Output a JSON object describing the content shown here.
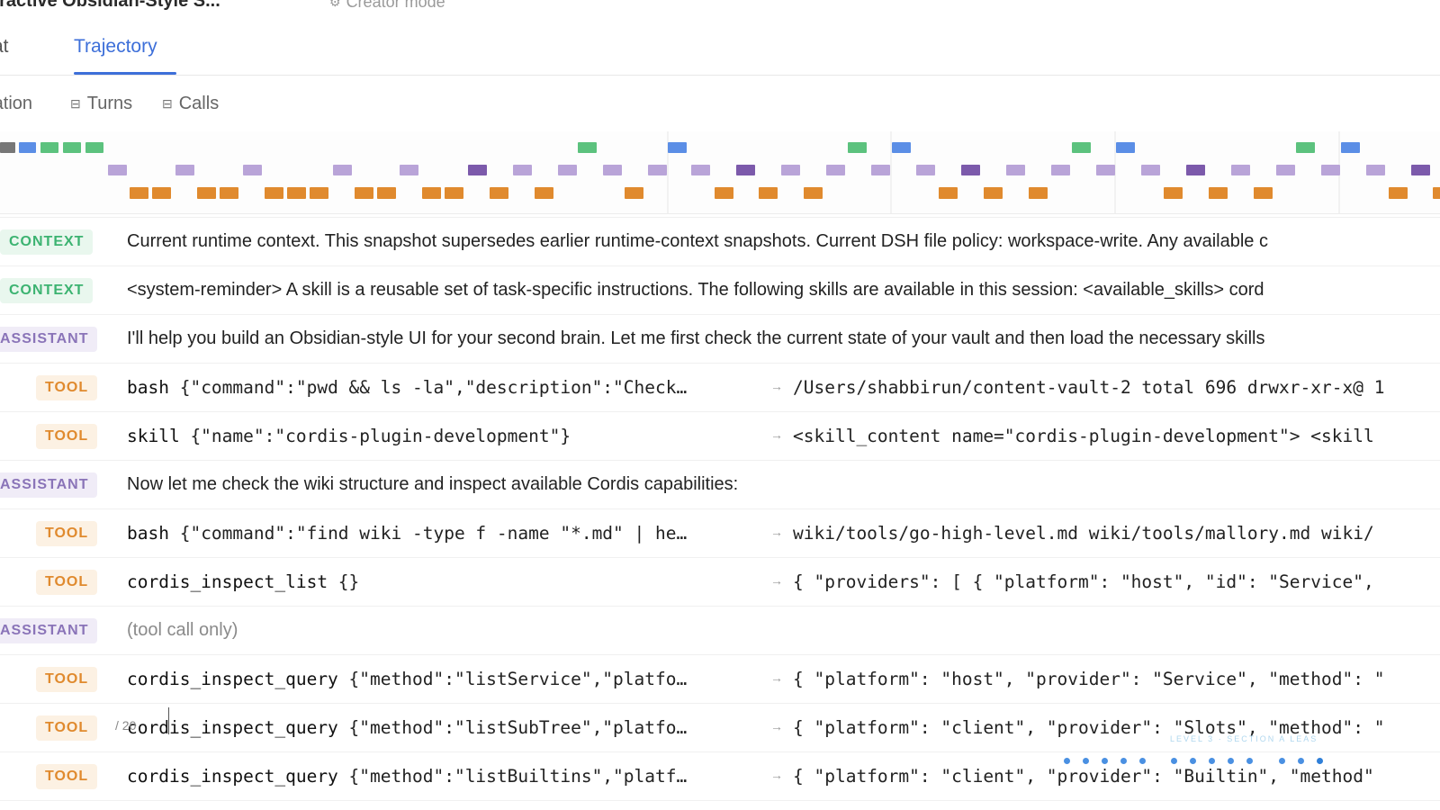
{
  "header": {
    "title": "eractive Obsidian-Style S...",
    "creator_label": "Creator mode",
    "creator_icon": "user-gear-icon"
  },
  "tabs": [
    {
      "label": "at",
      "active": false
    },
    {
      "label": "Trajectory",
      "active": true
    }
  ],
  "view_toggles": [
    {
      "label": "ration"
    },
    {
      "label": "Turns",
      "icon": "square-minus-icon"
    },
    {
      "label": "Calls",
      "icon": "square-minus-icon"
    }
  ],
  "timeline": {
    "colors": {
      "context": "#5cc27e",
      "assistant": "#5b8ee6",
      "thinking": "#b9a4d8",
      "thinking_strong": "#7c5aab",
      "tool": "#e08a2e",
      "system": "#777777"
    }
  },
  "rows": [
    {
      "kind": "CONTEXT",
      "text": "Current runtime context. This snapshot supersedes earlier runtime-context snapshots. Current DSH file policy: workspace-write. Any available c"
    },
    {
      "kind": "CONTEXT",
      "text": "<system-reminder> A skill is a reusable set of task-specific instructions. The following skills are available in this session: <available_skills> cord"
    },
    {
      "kind": "ASSISTANT",
      "text": "I'll help you build an Obsidian-style UI for your second brain. Let me first check the current state of your vault and then load the necessary skills"
    },
    {
      "kind": "TOOL",
      "name": "bash",
      "args": "{\"command\":\"pwd && ls -la\",\"description\":\"Check…",
      "result": "/Users/shabbirun/content-vault-2 total 696 drwxr-xr-x@ 1"
    },
    {
      "kind": "TOOL",
      "name": "skill",
      "args": "{\"name\":\"cordis-plugin-development\"}",
      "result": "<skill_content name=\"cordis-plugin-development\"> <skill"
    },
    {
      "kind": "ASSISTANT",
      "text": "Now let me check the wiki structure and inspect available Cordis capabilities:"
    },
    {
      "kind": "TOOL",
      "name": "bash",
      "args": "{\"command\":\"find wiki -type f -name \"*.md\" | he…",
      "result": "wiki/tools/go-high-level.md wiki/tools/mallory.md wiki/"
    },
    {
      "kind": "TOOL",
      "name": "cordis_inspect_list",
      "args": "{}",
      "result": "{ \"providers\": [ { \"platform\": \"host\", \"id\": \"Service\","
    },
    {
      "kind": "ASSISTANT",
      "text": "(tool call only)",
      "muted": true
    },
    {
      "kind": "TOOL",
      "name": "cordis_inspect_query",
      "args": "{\"method\":\"listService\",\"platfo…",
      "result": "{ \"platform\": \"host\", \"provider\": \"Service\", \"method\": \""
    },
    {
      "kind": "TOOL",
      "name": "cordis_inspect_query",
      "args": "{\"method\":\"listSubTree\",\"platfo…",
      "result": "{ \"platform\": \"client\", \"provider\": \"Slots\", \"method\": \""
    },
    {
      "kind": "TOOL",
      "name": "cordis_inspect_query",
      "args": "{\"method\":\"listBuiltins\",\"platf…",
      "result": "{ \"platform\": \"client\", \"provider\": \"Builtin\", \"method\""
    }
  ],
  "overlay": {
    "pager": "/ 20",
    "progress_caption": "LEVEL 3 · SECTION A LEAS"
  }
}
